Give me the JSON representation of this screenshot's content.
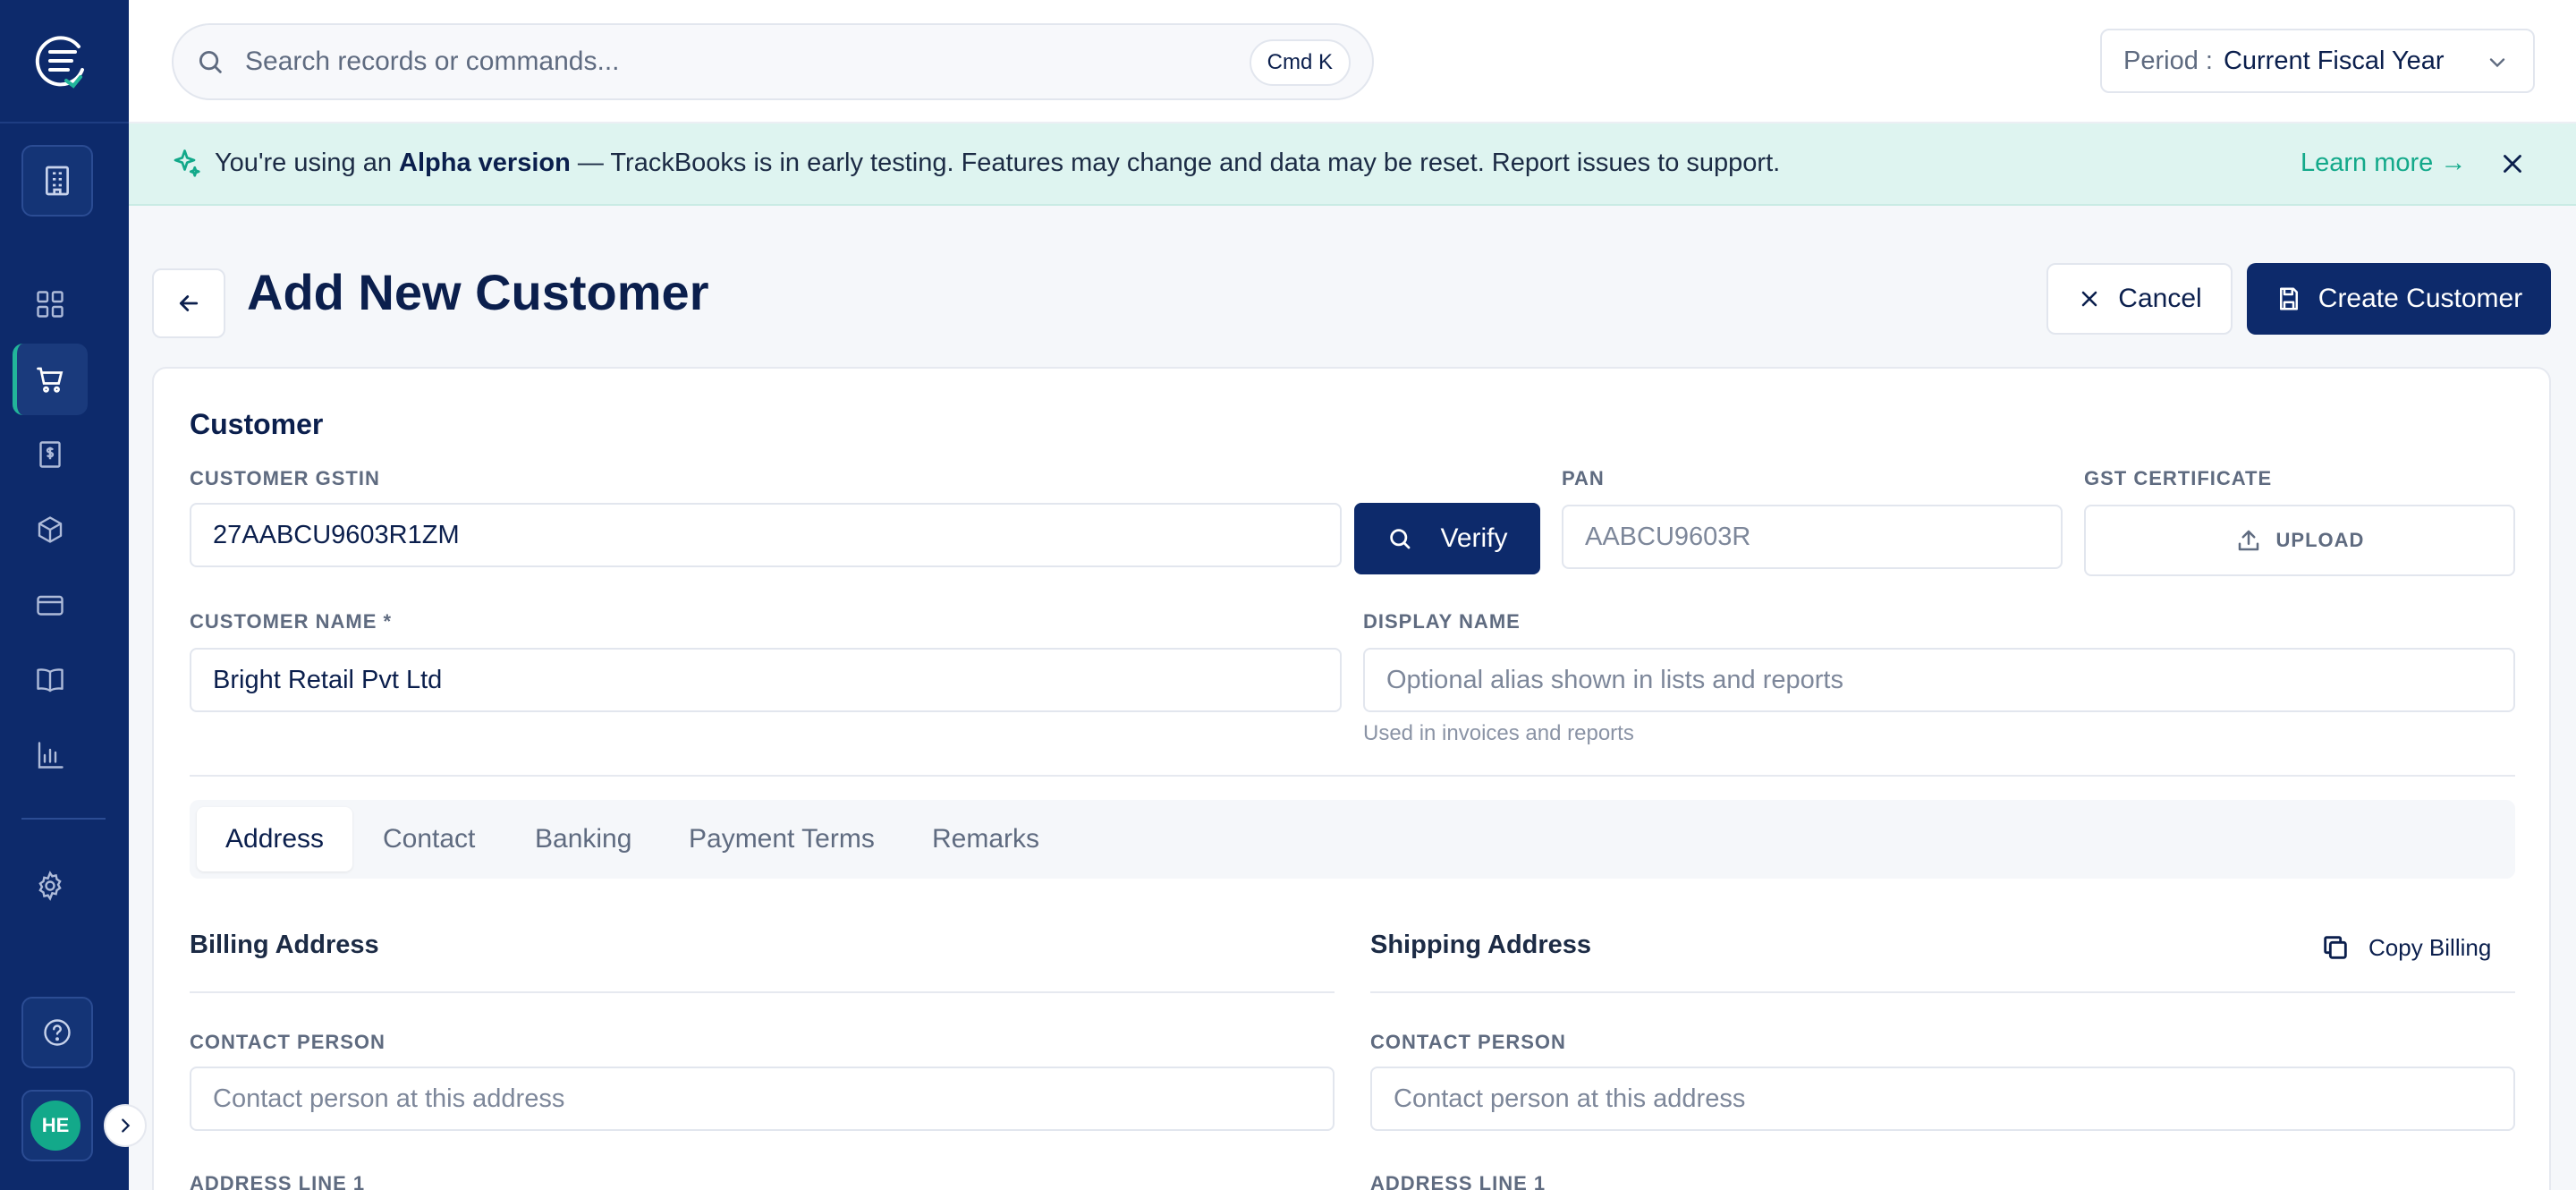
{
  "sidebar": {
    "avatar_initials": "HE"
  },
  "search": {
    "placeholder": "Search records or commands...",
    "shortcut": "Cmd K"
  },
  "period": {
    "label": "Period :",
    "value": "Current Fiscal Year"
  },
  "banner": {
    "text_prefix": "You're using an ",
    "text_bold": "Alpha version",
    "text_suffix": " — TrackBooks is in early testing. Features may change and data may be reset. Report issues to support.",
    "link": "Learn more →"
  },
  "header": {
    "title": "Add New Customer",
    "cancel_label": "Cancel",
    "create_label": "Create Customer"
  },
  "customer": {
    "section_title": "Customer",
    "gstin_label": "CUSTOMER GSTIN",
    "gstin_value": "27AABCU9603R1ZM",
    "verify_label": "Verify",
    "pan_label": "PAN",
    "pan_placeholder": "AABCU9603R",
    "gst_cert_label": "GST CERTIFICATE",
    "upload_label": "UPLOAD",
    "name_label": "CUSTOMER NAME *",
    "name_value": "Bright Retail Pvt Ltd",
    "display_label": "DISPLAY NAME",
    "display_placeholder": "Optional alias shown in lists and reports",
    "display_hint": "Used in invoices and reports"
  },
  "tabs": [
    {
      "label": "Address",
      "active": true
    },
    {
      "label": "Contact",
      "active": false
    },
    {
      "label": "Banking",
      "active": false
    },
    {
      "label": "Payment Terms",
      "active": false
    },
    {
      "label": "Remarks",
      "active": false
    }
  ],
  "billing": {
    "title": "Billing Address",
    "contact_label": "CONTACT PERSON",
    "contact_placeholder": "Contact person at this address",
    "address1_label": "ADDRESS LINE 1"
  },
  "shipping": {
    "title": "Shipping Address",
    "copy_label": "Copy Billing",
    "contact_label": "CONTACT PERSON",
    "contact_placeholder": "Contact person at this address",
    "address1_label": "ADDRESS LINE 1"
  }
}
